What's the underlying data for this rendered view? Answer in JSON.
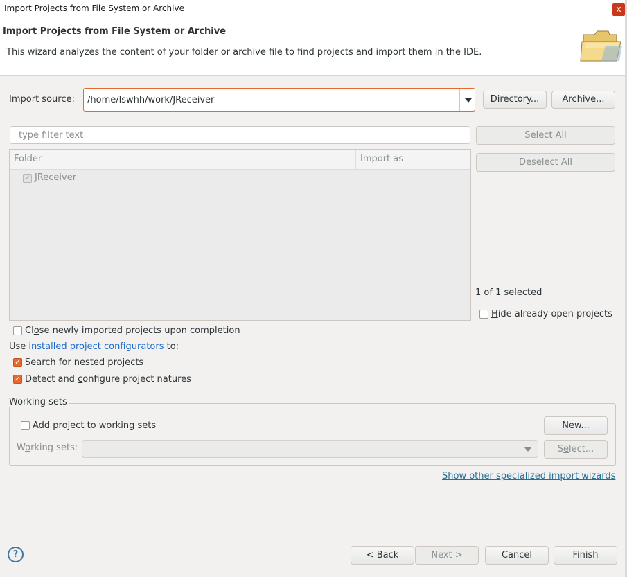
{
  "window": {
    "title": "Import Projects from File System or Archive",
    "close_label": "x"
  },
  "header": {
    "title": "Import Projects from File System or Archive",
    "description": "This wizard analyzes the content of your folder or archive file to find projects and import them in the IDE.",
    "icon": "folder-open-icon"
  },
  "import_source": {
    "label_pre": "I",
    "label_ul": "m",
    "label_post": "port source:",
    "value": "/home/lswhh/work/JReceiver",
    "directory_pre": "Dir",
    "directory_ul": "e",
    "directory_post": "ctory...",
    "archive_pre": "",
    "archive_ul": "A",
    "archive_post": "rchive..."
  },
  "filter": {
    "placeholder": "type filter text"
  },
  "selection": {
    "select_all_pre": "",
    "select_all_ul": "S",
    "select_all_post": "elect All",
    "deselect_all_pre": "",
    "deselect_all_ul": "D",
    "deselect_all_post": "eselect All",
    "count_text": "1 of 1 selected",
    "hide_open_pre": "",
    "hide_open_ul": "H",
    "hide_open_post": "ide already open projects"
  },
  "table": {
    "headers": [
      "Folder",
      "Import as"
    ],
    "rows": [
      {
        "folder": "JReceiver",
        "import_as": "",
        "checked": true,
        "disabled": true
      }
    ]
  },
  "options": {
    "close_projects_pre": "Cl",
    "close_projects_ul": "o",
    "close_projects_post": "se newly imported projects upon completion",
    "use_pre": "Use ",
    "use_link": "installed project configurators",
    "use_post": " to:",
    "search_nested_pre": "Search for nested ",
    "search_nested_ul": "p",
    "search_nested_post": "rojects",
    "detect_natures_pre": "Detect and ",
    "detect_natures_ul": "c",
    "detect_natures_post": "onfigure project natures"
  },
  "working_sets": {
    "group_label": "Working sets",
    "add_pre": "Add projec",
    "add_ul": "t",
    "add_post": " to working sets",
    "new_pre": "Ne",
    "new_ul": "w",
    "new_post": "...",
    "sets_pre": "W",
    "sets_ul": "o",
    "sets_post": "rking sets:",
    "select_pre": "S",
    "select_ul": "e",
    "select_post": "lect..."
  },
  "other_wizards_link": "Show other specialized import wizards",
  "footer": {
    "back": "< Back",
    "next": "Next >",
    "cancel": "Cancel",
    "finish": "Finish",
    "help_label": "?"
  },
  "colors": {
    "accent": "#e6692f",
    "link": "#1b6acb",
    "background": "#f2f1f0"
  }
}
